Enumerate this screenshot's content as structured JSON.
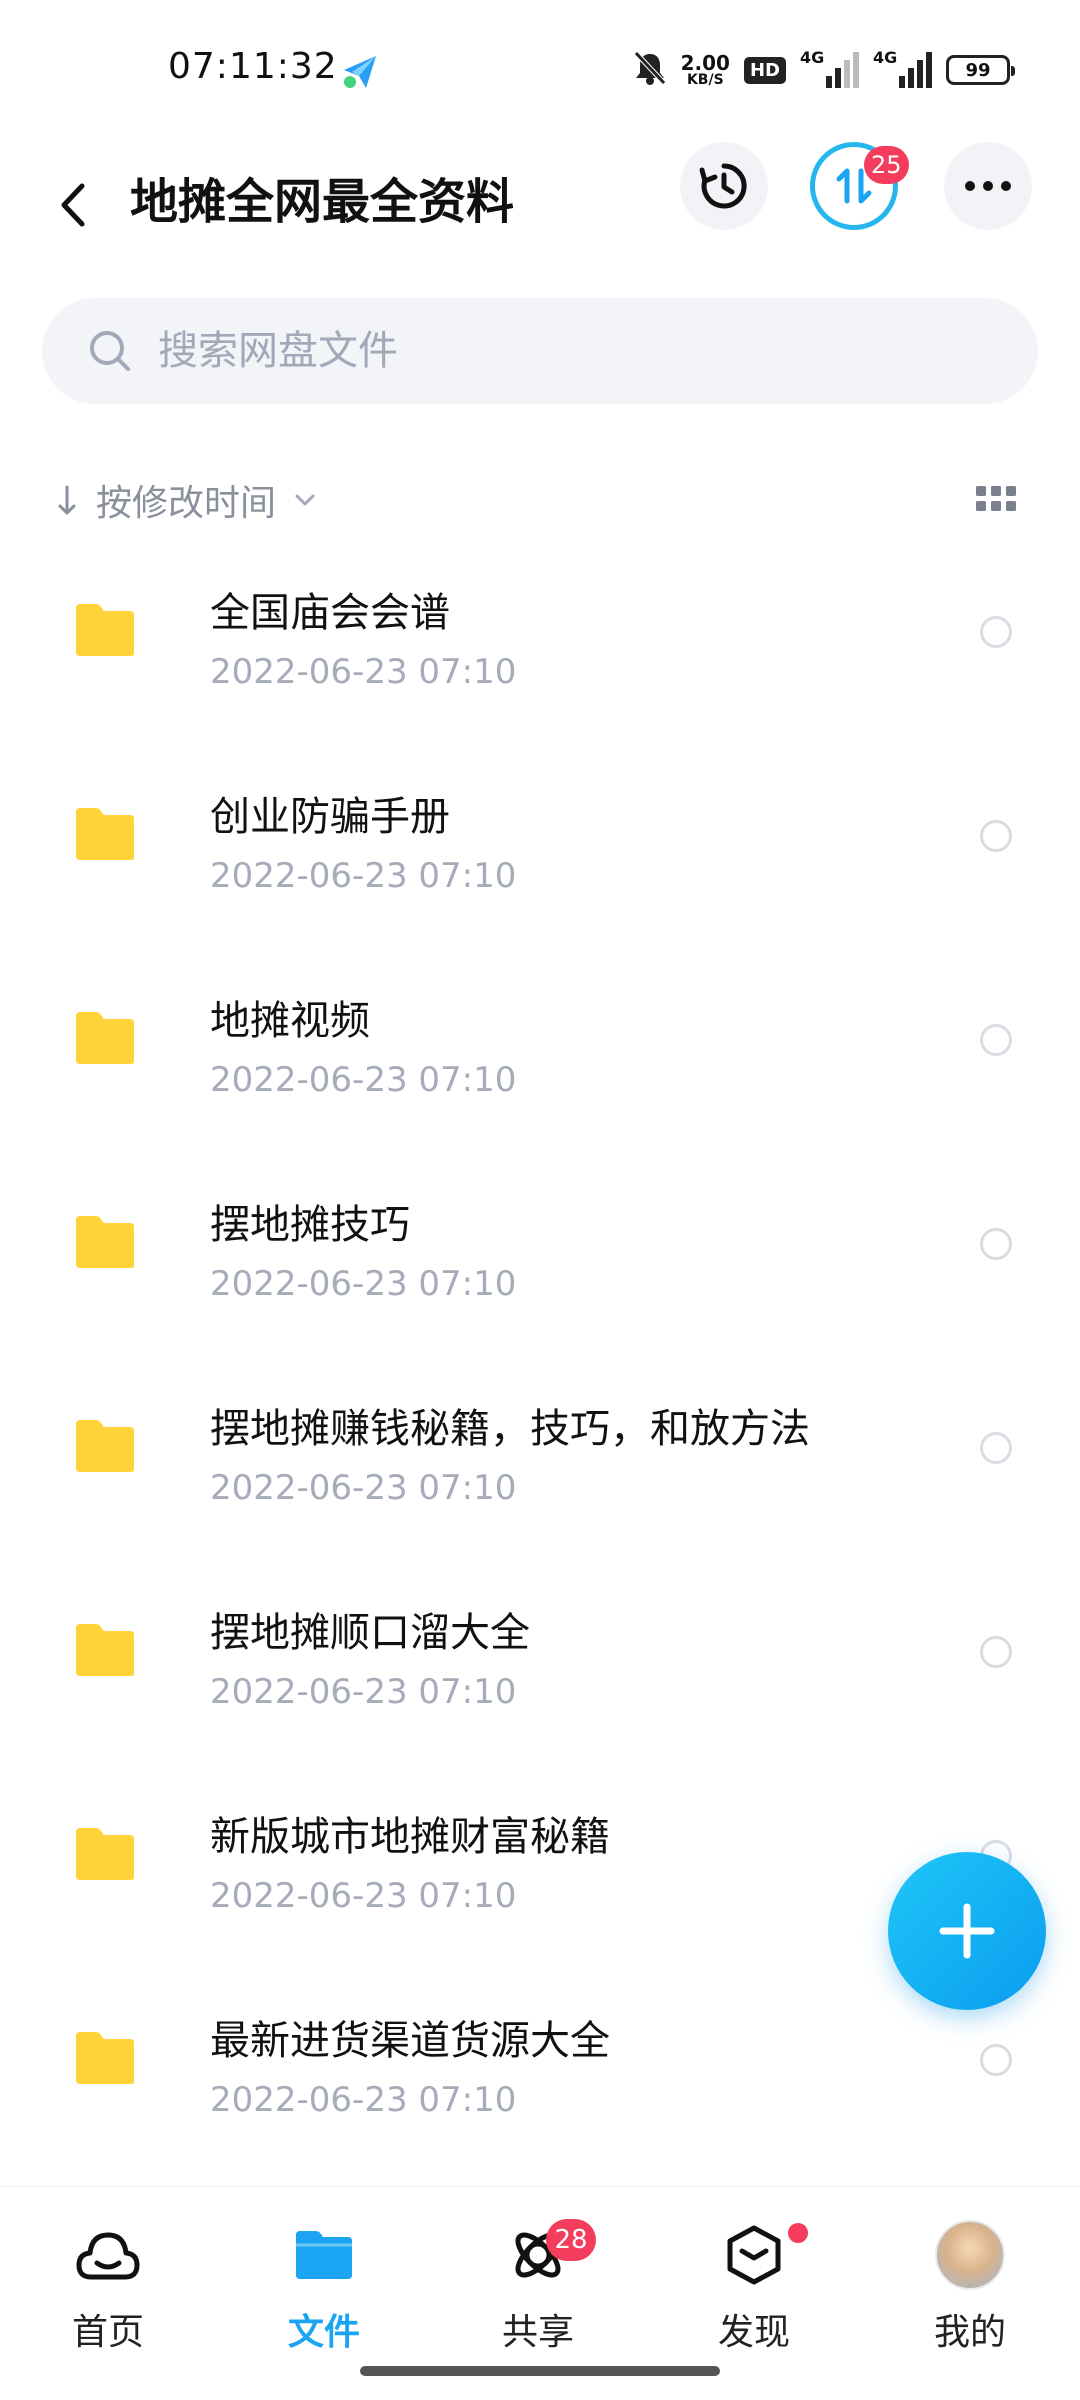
{
  "status_bar": {
    "time": "07:11:32",
    "net_speed_value": "2.00",
    "net_speed_unit": "KB/S",
    "hd_label": "HD",
    "signal_label_1": "4G",
    "signal_label_2": "4G",
    "battery": "99"
  },
  "header": {
    "title": "地摊全网最全资料",
    "transfer_badge": "25"
  },
  "search": {
    "placeholder": "搜索网盘文件"
  },
  "sort": {
    "label": "按修改时间"
  },
  "files": [
    {
      "name": "全国庙会会谱",
      "date": "2022-06-23  07:10"
    },
    {
      "name": "创业防骗手册",
      "date": "2022-06-23  07:10"
    },
    {
      "name": "地摊视频",
      "date": "2022-06-23  07:10"
    },
    {
      "name": "摆地摊技巧",
      "date": "2022-06-23  07:10"
    },
    {
      "name": "摆地摊赚钱秘籍，技巧，和放方法",
      "date": "2022-06-23  07:10"
    },
    {
      "name": "摆地摊顺口溜大全",
      "date": "2022-06-23  07:10"
    },
    {
      "name": "新版城市地摊财富秘籍",
      "date": "2022-06-23  07:10"
    },
    {
      "name": "最新进货渠道货源大全",
      "date": "2022-06-23  07:10"
    }
  ],
  "nav": {
    "home": "首页",
    "files": "文件",
    "share": "共享",
    "share_badge": "28",
    "discover": "发现",
    "mine": "我的"
  },
  "colors": {
    "accent": "#1aa4f2",
    "folder": "#ffd43b",
    "badge": "#f43d5c"
  },
  "icons": {
    "back": "chevron-left-icon",
    "history": "history-icon",
    "transfer": "transfer-icon",
    "more": "more-icon",
    "search": "search-icon",
    "sort": "arrow-down-icon",
    "grid": "grid-view-icon",
    "folder": "folder-icon",
    "fab": "plus-icon"
  }
}
